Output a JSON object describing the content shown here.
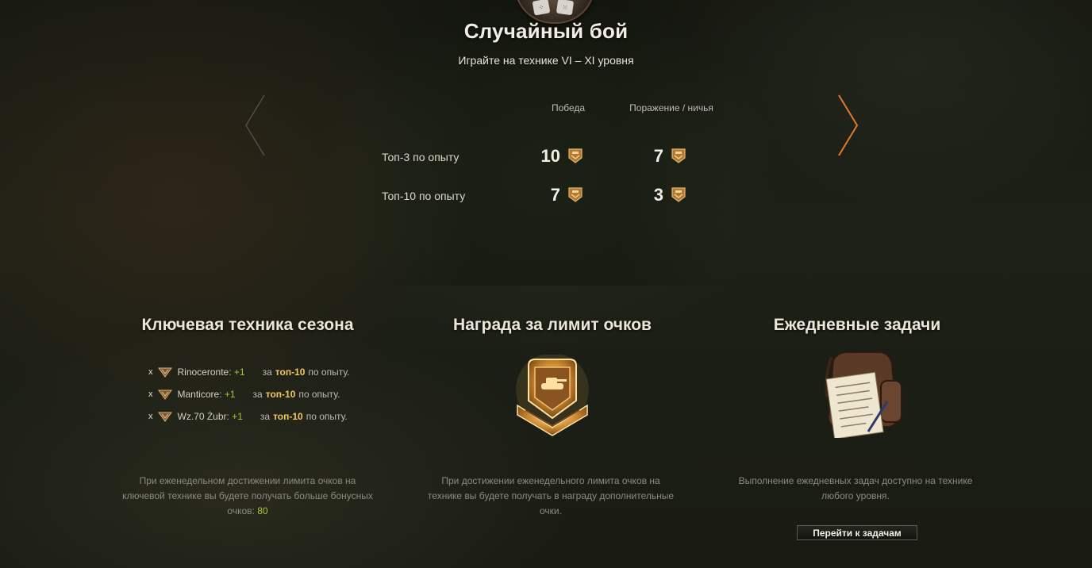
{
  "header": {
    "title": "Случайный бой",
    "subtitle": "Играйте на технике VI – XI уровня"
  },
  "table": {
    "columns": [
      "Победа",
      "Поражение / ничья"
    ],
    "rows": [
      {
        "label": "Топ-3 по опыту",
        "win": "10",
        "lose": "7"
      },
      {
        "label": "Топ-10 по опыту",
        "win": "7",
        "lose": "3"
      }
    ]
  },
  "key_vehicles": {
    "title": "Ключевая техника сезона",
    "items": [
      {
        "x": "x",
        "tank": "Rinoceronte",
        "bonus": "+1",
        "za": "за",
        "top": "топ-10",
        "suffix": "по опыту."
      },
      {
        "x": "x",
        "tank": "Manticore",
        "bonus": "+1",
        "za": "за",
        "top": "топ-10",
        "suffix": "по опыту."
      },
      {
        "x": "x",
        "tank": "Wz.70 Żubr",
        "bonus": "+1",
        "za": "за",
        "top": "топ-10",
        "suffix": "по опыту."
      }
    ],
    "description": "При еженедельном достижении лимита очков на ключевой технике вы будете получать больше бонусных очков:",
    "description_value": "80"
  },
  "limit_reward": {
    "title": "Награда за лимит очков",
    "description": "При достижении еженедельного лимита очков на технике вы будете получать в награду дополнительные очки."
  },
  "daily_tasks": {
    "title": "Ежедневные задачи",
    "description": "Выполнение ежедневных задач доступно на технике любого уровня.",
    "button_label": "Перейти к задачам"
  },
  "icons": {
    "emblem": "dice-icon",
    "nav_left": "chevron-left-icon",
    "nav_right": "chevron-right-icon",
    "points": "battle-points-icon",
    "medal": "tank-medal-icon",
    "case": "task-case-icon"
  },
  "colors": {
    "accent_green": "#a6c832",
    "accent_gold": "#f0c860",
    "nav_active": "#e07a2a"
  }
}
